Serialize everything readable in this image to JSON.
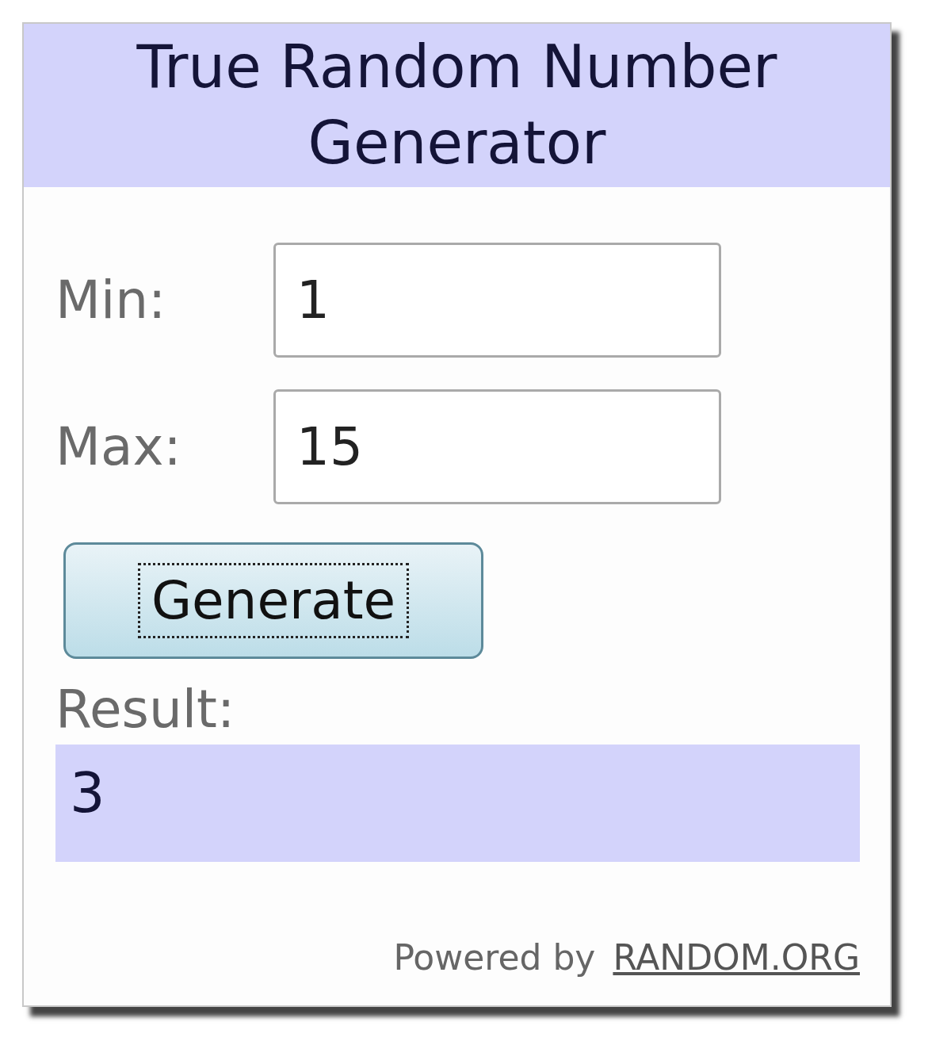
{
  "widget": {
    "title": "True Random Number Generator"
  },
  "fields": [
    {
      "label": "Min:",
      "value": "1"
    },
    {
      "label": "Max:",
      "value": "15"
    }
  ],
  "button": {
    "label": "Generate",
    "focused": true
  },
  "result": {
    "label": "Result:",
    "value": "3"
  },
  "footer": {
    "text": "Powered by",
    "link": "RANDOM.ORG"
  }
}
